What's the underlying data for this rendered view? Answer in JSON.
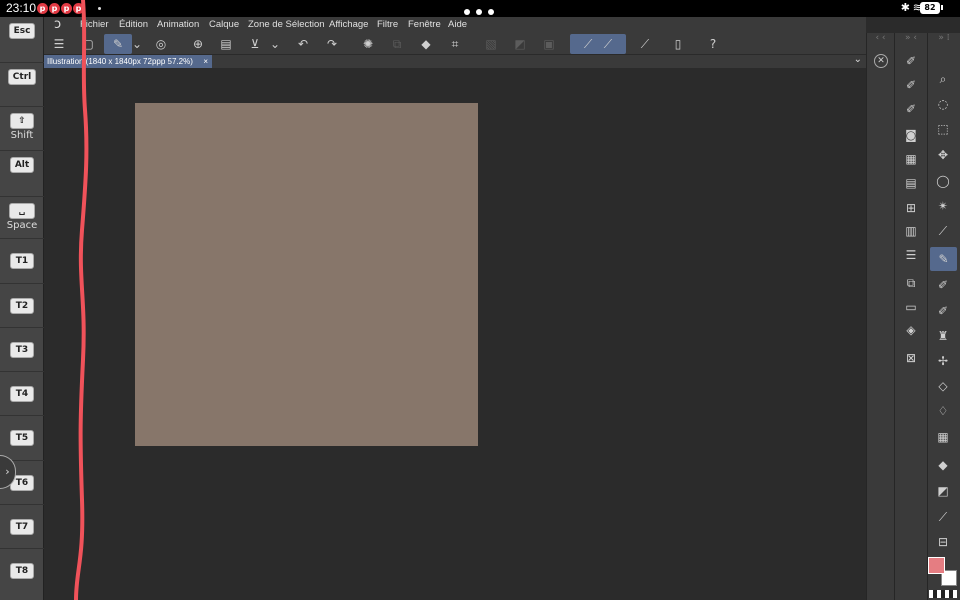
{
  "status": {
    "time": "23:10",
    "notification_count": 4,
    "battery": "82"
  },
  "keys": [
    {
      "cap": "Esc",
      "label": ""
    },
    {
      "cap": "Ctrl",
      "label": ""
    },
    {
      "cap": "⇧",
      "label": "Shift"
    },
    {
      "cap": "Alt",
      "label": ""
    },
    {
      "cap": "␣",
      "label": "Space"
    },
    {
      "cap": "T1",
      "label": ""
    },
    {
      "cap": "T2",
      "label": ""
    },
    {
      "cap": "T3",
      "label": ""
    },
    {
      "cap": "T4",
      "label": ""
    },
    {
      "cap": "T5",
      "label": ""
    },
    {
      "cap": "T6",
      "label": ""
    },
    {
      "cap": "T7",
      "label": ""
    },
    {
      "cap": "T8",
      "label": ""
    }
  ],
  "menu": [
    "Fichier",
    "Édition",
    "Animation",
    "Calque",
    "Zone de Sélection",
    "Affichage",
    "Filtre",
    "Fenêtre",
    "Aide"
  ],
  "tab": {
    "title": "Illustration (1840 x 1840px 72ppp 57.2%)",
    "close": "×"
  },
  "colors": {
    "paper": "#87766a",
    "accent": "#55698d",
    "main_color": "#e57d82",
    "sub_color": "#ffffff",
    "stroke": "#f0525a"
  },
  "toolbar_icons": [
    "hamburger-icon",
    "new-canvas-icon",
    "pen-mode-icon",
    "dropdown-icon",
    "settings-icon",
    "add-layer-icon",
    "open-folder-icon",
    "save-icon",
    "dropdown-icon",
    "undo-icon",
    "redo-icon",
    "loading-icon",
    "copy-icon",
    "fill-icon",
    "crop-icon",
    "transparent-icon",
    "gradient-icon",
    "border-icon",
    "stroke-line-icon",
    "brush-icon",
    "ruler-icon",
    "phone-icon",
    "help-icon"
  ],
  "tool_icons": [
    "zoom-icon",
    "rotate-view-icon",
    "select-object-icon",
    "move-icon",
    "lasso-icon",
    "magic-wand-icon",
    "eyedropper-icon",
    "pen-icon",
    "pencil-icon",
    "brush-icon",
    "airbrush-icon",
    "decoration-icon",
    "eraser-icon",
    "blend-icon",
    "figure-icon",
    "fill-icon",
    "gradient-icon",
    "line-icon",
    "frame-icon"
  ],
  "panel_icons": [
    "tool-property-icon",
    "brush-size-icon",
    "color-wheel-icon",
    "color-set-icon",
    "layer-property-icon",
    "navigator-icon",
    "sub-view-icon",
    "layer-icon",
    "item-bank-icon",
    "material-icon",
    "history-icon",
    "timeline-icon",
    "layer-search-icon",
    "quick-access-icon"
  ]
}
